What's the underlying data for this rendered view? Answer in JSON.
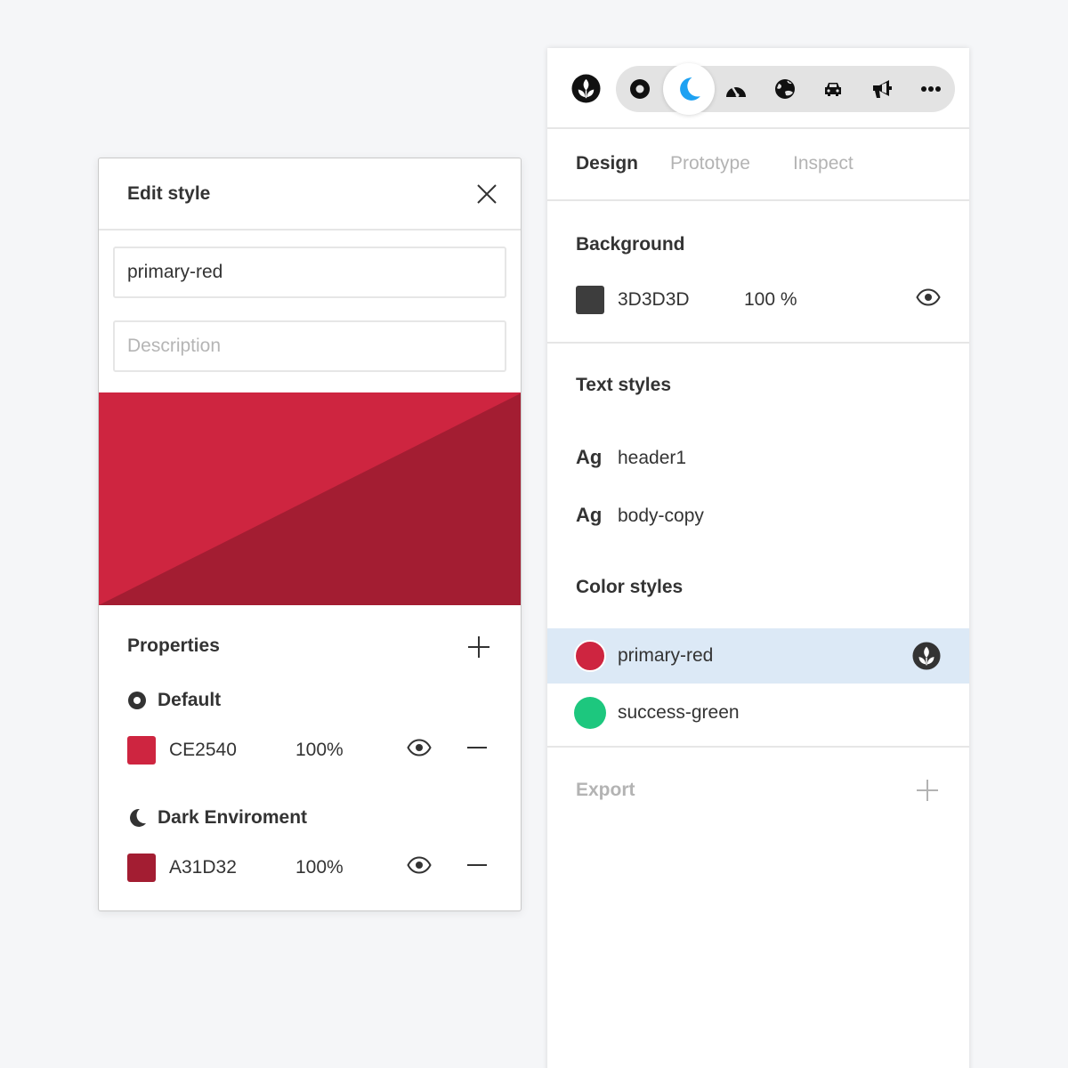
{
  "edit_style": {
    "title": "Edit style",
    "name_value": "primary-red",
    "description_placeholder": "Description",
    "preview": {
      "light_color": "#CE2540",
      "dark_color": "#A31D32"
    },
    "properties_title": "Properties",
    "modes": [
      {
        "label": "Default",
        "icon": "circle-dot-icon",
        "hex": "CE2540",
        "swatch_color": "#CE2540",
        "opacity": "100%"
      },
      {
        "label": "Dark Enviroment",
        "icon": "moon-icon",
        "hex": "A31D32",
        "swatch_color": "#A31D32",
        "opacity": "100%"
      }
    ]
  },
  "design_panel": {
    "toolbar": {
      "logo_icon": "leaf-logo-icon",
      "modes": [
        {
          "icon": "circle-dot-icon",
          "active": false
        },
        {
          "icon": "moon-icon",
          "active": true,
          "color": "#1DA1F2"
        },
        {
          "icon": "speedometer-icon",
          "active": false
        },
        {
          "icon": "globe-icon",
          "active": false
        },
        {
          "icon": "car-icon",
          "active": false
        },
        {
          "icon": "megaphone-icon",
          "active": false
        },
        {
          "icon": "more-dots-icon",
          "active": false
        }
      ]
    },
    "tabs": [
      {
        "label": "Design",
        "active": true
      },
      {
        "label": "Prototype",
        "active": false
      },
      {
        "label": "Inspect",
        "active": false
      }
    ],
    "background": {
      "title": "Background",
      "hex": "3D3D3D",
      "swatch_color": "#3D3D3D",
      "opacity": "100 %"
    },
    "text_styles": {
      "title": "Text styles",
      "items": [
        {
          "sample": "Ag",
          "name": "header1"
        },
        {
          "sample": "Ag",
          "name": "body-copy"
        }
      ]
    },
    "color_styles": {
      "title": "Color styles",
      "items": [
        {
          "name": "primary-red",
          "color": "#CE2540",
          "selected": true
        },
        {
          "name": "success-green",
          "color": "#1DC77E",
          "selected": false
        }
      ]
    },
    "export": {
      "title": "Export"
    }
  },
  "colors": {
    "page_background": "#F5F6F8",
    "selection": "#DCE9F6",
    "accent_blue": "#1DA1F2",
    "text": "#333333",
    "muted_text": "#B3B3B3"
  }
}
